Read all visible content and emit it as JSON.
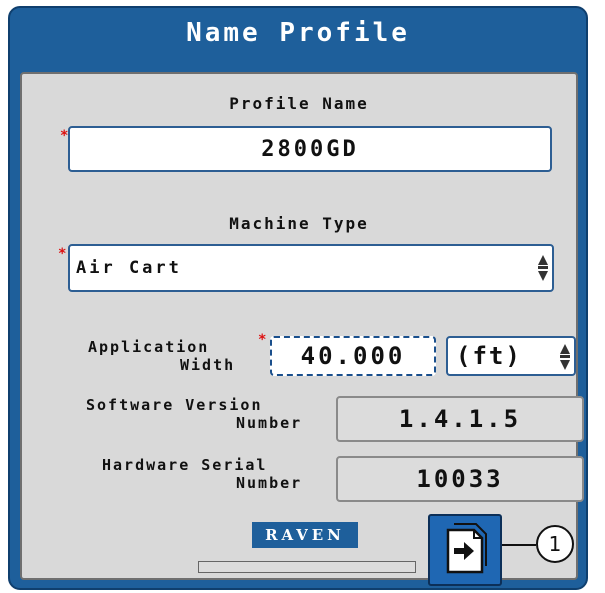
{
  "window": {
    "title": "Name Profile"
  },
  "profile_name": {
    "label": "Profile Name",
    "required_mark": "*",
    "value": "2800GD"
  },
  "machine_type": {
    "label": "Machine Type",
    "required_mark": "*",
    "value": "Air Cart"
  },
  "application_width": {
    "label_line1": "Application",
    "label_line2": "Width",
    "required_mark": "*",
    "value": "40.000",
    "unit": "(ft)"
  },
  "software_version": {
    "label_line1": "Software Version",
    "label_line2": "Number",
    "value": "1.4.1.5"
  },
  "hardware_serial": {
    "label_line1": "Hardware Serial",
    "label_line2": "Number",
    "value": "10033"
  },
  "brand": {
    "logo_text": "RAVEN"
  },
  "progress": {
    "fraction": 0
  },
  "callout": {
    "number": "1"
  },
  "icons": {
    "next_button": "page-arrow-icon",
    "spinner": "up-down-spinner-icon"
  },
  "colors": {
    "frame": "#1e5f9b",
    "panel": "#d9d9d9",
    "required": "#dd1111",
    "button": "#1f67b3"
  }
}
